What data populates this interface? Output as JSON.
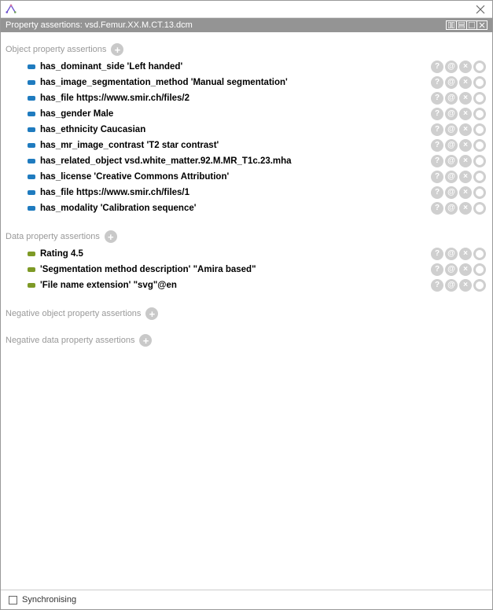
{
  "titlebar": {
    "app": ""
  },
  "panel": {
    "title": "Property assertions: vsd.Femur.XX.M.CT.13.dcm"
  },
  "sections": {
    "obj": {
      "label": "Object property assertions"
    },
    "data": {
      "label": "Data property assertions"
    },
    "negobj": {
      "label": "Negative object property assertions"
    },
    "negdata": {
      "label": "Negative data property assertions"
    }
  },
  "object_assertions": [
    {
      "prop": "has_dominant_side",
      "val": "'Left handed'"
    },
    {
      "prop": "has_image_segmentation_method",
      "val": "'Manual segmentation'"
    },
    {
      "prop": "has_file",
      "val": "https://www.smir.ch/files/2"
    },
    {
      "prop": "has_gender",
      "val": "Male"
    },
    {
      "prop": "has_ethnicity",
      "val": "Caucasian"
    },
    {
      "prop": "has_mr_image_contrast",
      "val": "'T2 star contrast'"
    },
    {
      "prop": "has_related_object",
      "val": "vsd.white_matter.92.M.MR_T1c.23.mha"
    },
    {
      "prop": "has_license",
      "val": "'Creative Commons Attribution'"
    },
    {
      "prop": "has_file",
      "val": "https://www.smir.ch/files/1"
    },
    {
      "prop": "has_modality",
      "val": "'Calibration sequence'"
    }
  ],
  "data_assertions": [
    {
      "prop": "Rating",
      "val": "4.5"
    },
    {
      "prop": "'Segmentation method description'",
      "val": "\"Amira based\""
    },
    {
      "prop": "'File name extension'",
      "val": "\"svg\"@en"
    }
  ],
  "footer": {
    "sync_label": "Synchronising"
  }
}
